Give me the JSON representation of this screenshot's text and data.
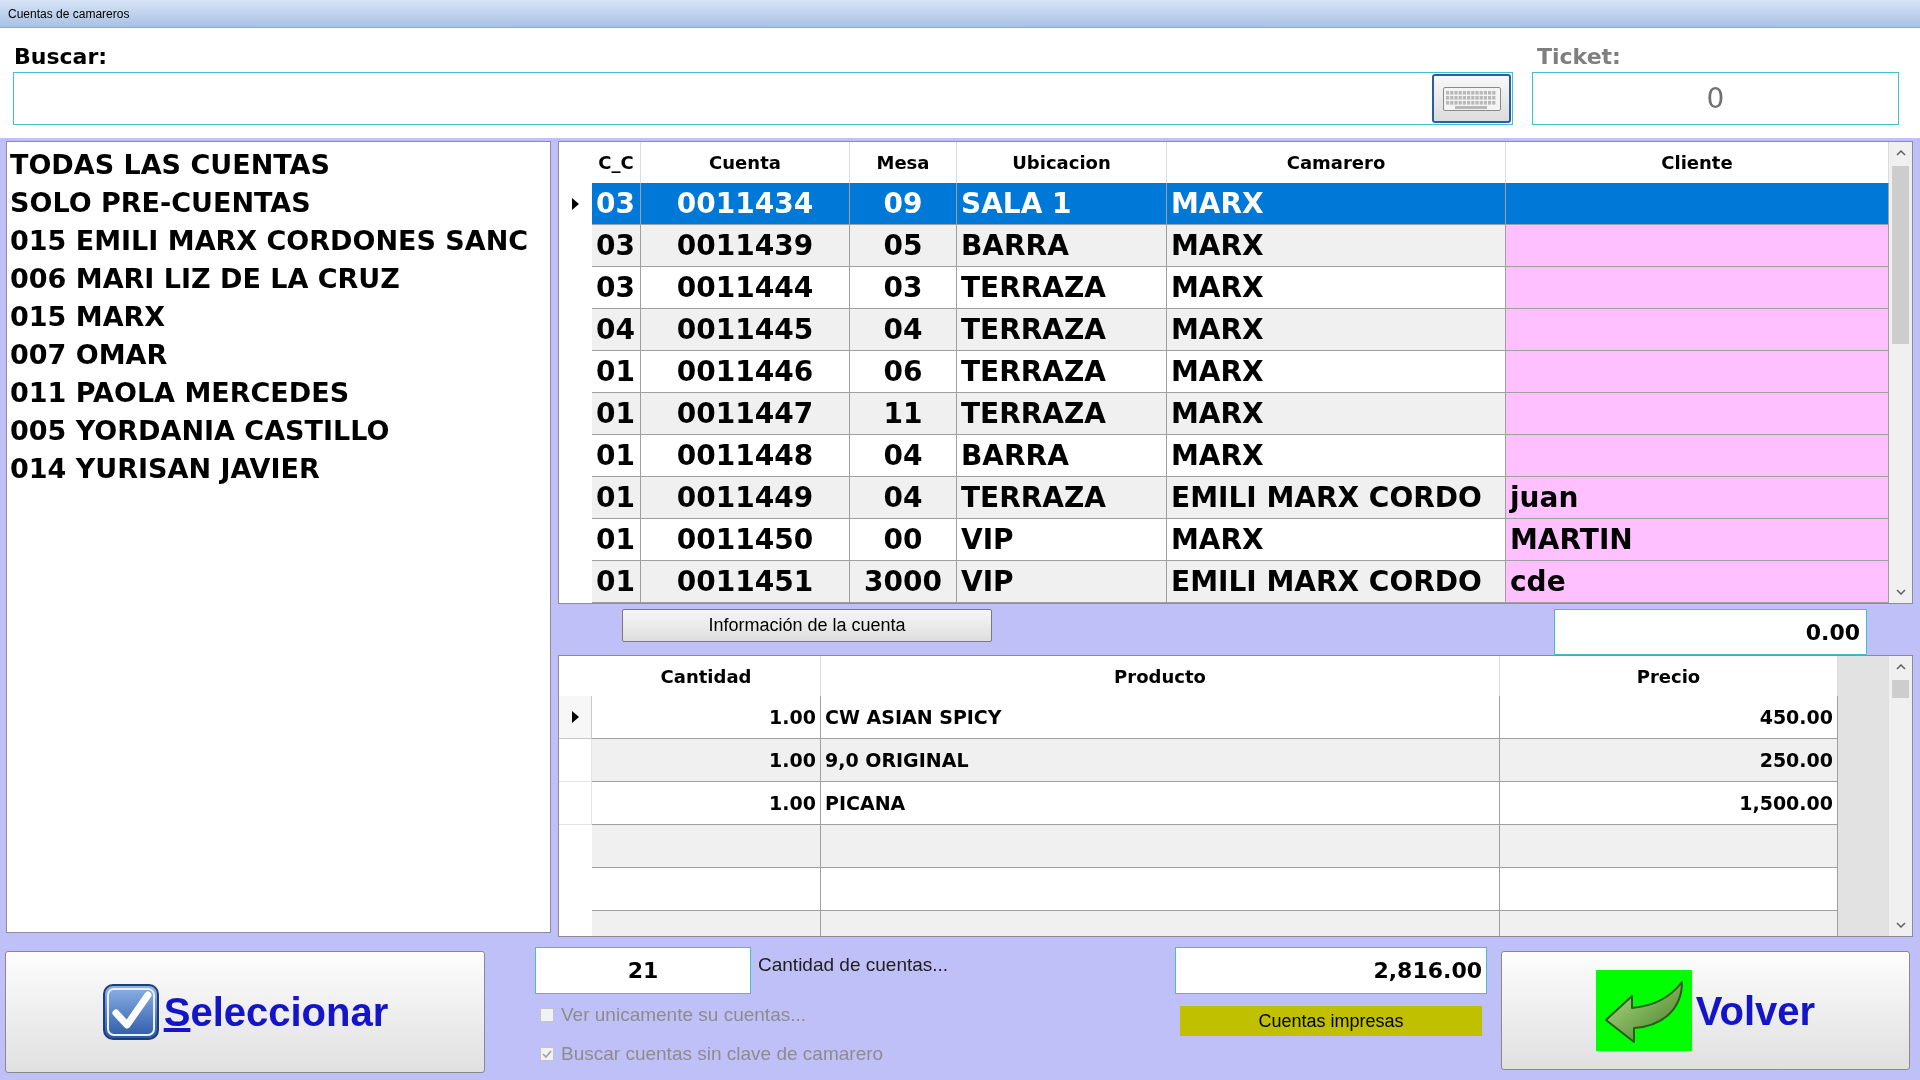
{
  "window": {
    "title": "Cuentas de camareros"
  },
  "search": {
    "label": "Buscar:"
  },
  "ticket": {
    "label": "Ticket:",
    "value": "0"
  },
  "waiters": [
    "TODAS LAS CUENTAS",
    "SOLO PRE-CUENTAS",
    "015 EMILI MARX CORDONES SANC",
    "006 MARI LIZ DE LA CRUZ",
    "015 MARX",
    "007 OMAR",
    "011 PAOLA MERCEDES",
    "005 YORDANIA CASTILLO",
    "014 YURISAN JAVIER"
  ],
  "accounts_table": {
    "columns": [
      "C_C",
      "Cuenta",
      "Mesa",
      "Ubicacion",
      "Camarero",
      "Cliente"
    ],
    "rows": [
      {
        "c_c": "03",
        "cuenta": "0011434",
        "mesa": "09",
        "ubicacion": "SALA 1",
        "camarero": "MARX",
        "selected": true
      },
      {
        "c_c": "03",
        "cuenta": "0011439",
        "mesa": "05",
        "ubicacion": "BARRA",
        "camarero": "MARX",
        "selected": false
      },
      {
        "c_c": "03",
        "cuenta": "0011444",
        "mesa": "03",
        "ubicacion": "TERRAZA",
        "camarero": "MARX",
        "selected": false
      },
      {
        "c_c": "04",
        "cuenta": "0011445",
        "mesa": "04",
        "ubicacion": "TERRAZA",
        "camarero": "MARX",
        "selected": false
      },
      {
        "c_c": "01",
        "cuenta": "0011446",
        "mesa": "06",
        "ubicacion": "TERRAZA",
        "camarero": "MARX",
        "selected": false
      },
      {
        "c_c": "01",
        "cuenta": "0011447",
        "mesa": "11",
        "ubicacion": "TERRAZA",
        "camarero": "MARX",
        "selected": false
      },
      {
        "c_c": "01",
        "cuenta": "0011448",
        "mesa": "04",
        "ubicacion": "BARRA",
        "camarero": "MARX",
        "selected": false
      },
      {
        "c_c": "01",
        "cuenta": "0011449",
        "mesa": "04",
        "ubicacion": "TERRAZA",
        "camarero": "EMILI MARX CORDO",
        "cliente": "juan",
        "selected": false
      },
      {
        "c_c": "01",
        "cuenta": "0011450",
        "mesa": "00",
        "ubicacion": "VIP",
        "camarero": "MARX",
        "cliente": "MARTIN",
        "selected": false
      },
      {
        "c_c": "01",
        "cuenta": "0011451",
        "mesa": "3000",
        "ubicacion": "VIP",
        "camarero": "EMILI MARX CORDO",
        "cliente": "cde",
        "selected": false
      }
    ]
  },
  "account_info_button": "Información de la cuenta",
  "account_amount": "0.00",
  "products_table": {
    "columns": [
      "Cantidad",
      "Producto",
      "Precio"
    ],
    "rows": [
      {
        "cantidad": "1.00",
        "producto": "CW ASIAN SPICY",
        "precio": "450.00",
        "current": true
      },
      {
        "cantidad": "1.00",
        "producto": "9,0 ORIGINAL",
        "precio": "250.00",
        "current": false
      },
      {
        "cantidad": "1.00",
        "producto": "PICANA",
        "precio": "1,500.00",
        "current": false
      }
    ]
  },
  "select_button": "Seleccionar",
  "account_count": {
    "value": "21",
    "label": "Cantidad de cuentas..."
  },
  "options": [
    {
      "label": "Ver unicamente su cuentas...",
      "checked": false,
      "disabled": true
    },
    {
      "label": "Buscar cuentas sin clave de camarero",
      "checked": true,
      "disabled": true
    }
  ],
  "total": "2,816.00",
  "printed_label": "Cuentas impresas",
  "back_button": "Volver"
}
